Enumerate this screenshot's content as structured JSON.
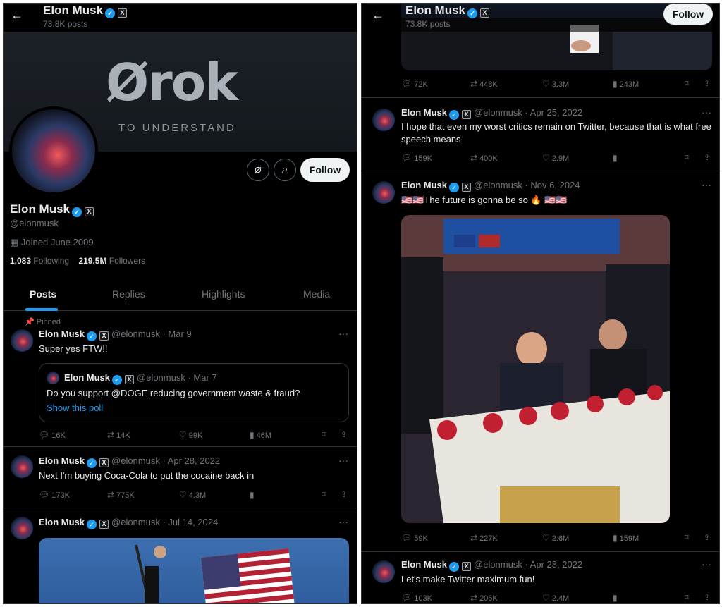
{
  "profile": {
    "name": "Elon Musk",
    "posts_count": "73.8K posts",
    "handle": "@elonmusk",
    "joined": "Joined June 2009",
    "following_count": "1,083",
    "following_label": "Following",
    "followers_count": "219.5M",
    "followers_label": "Followers",
    "follow_label": "Follow",
    "banner_word": "Ørok",
    "banner_sub": "TO UNDERSTAND"
  },
  "tabs": [
    "Posts",
    "Replies",
    "Highlights",
    "Media"
  ],
  "pinned_label": "Pinned",
  "left_tweets": [
    {
      "name": "Elon Musk",
      "meta": "@elonmusk · Mar 9",
      "text": "Super yes FTW!!",
      "quote": {
        "name": "Elon Musk",
        "meta": "@elonmusk · Mar 7",
        "text": "Do you support @DOGE reducing government waste & fraud?",
        "link": "Show this poll"
      },
      "replies": "16K",
      "retweets": "14K",
      "likes": "99K",
      "views": "46M"
    },
    {
      "name": "Elon Musk",
      "meta": "@elonmusk · Apr 28, 2022",
      "text": "Next I'm buying Coca-Cola to put the cocaine back in",
      "replies": "173K",
      "retweets": "775K",
      "likes": "4.3M",
      "views": ""
    },
    {
      "name": "Elon Musk",
      "meta": "@elonmusk · Jul 14, 2024",
      "text": ""
    }
  ],
  "right_top_stats": {
    "replies": "72K",
    "retweets": "448K",
    "likes": "3.3M",
    "views": "243M"
  },
  "right_tweets": [
    {
      "name": "Elon Musk",
      "meta": "@elonmusk · Apr 25, 2022",
      "text": "I hope that even my worst critics remain on Twitter, because that is what free speech means",
      "replies": "159K",
      "retweets": "400K",
      "likes": "2.9M",
      "views": ""
    },
    {
      "name": "Elon Musk",
      "meta": "@elonmusk · Nov 6, 2024",
      "text": "🇺🇸🇺🇸The future is gonna be so 🔥 🇺🇸🇺🇸",
      "replies": "59K",
      "retweets": "227K",
      "likes": "2.6M",
      "views": "159M"
    },
    {
      "name": "Elon Musk",
      "meta": "@elonmusk · Apr 28, 2022",
      "text": "Let's make Twitter maximum fun!",
      "replies": "103K",
      "retweets": "206K",
      "likes": "2.4M",
      "views": ""
    }
  ],
  "colors": {
    "background": "#000000",
    "accent": "#1d9bf0",
    "muted": "#71767b",
    "text": "#e7e9ea"
  }
}
